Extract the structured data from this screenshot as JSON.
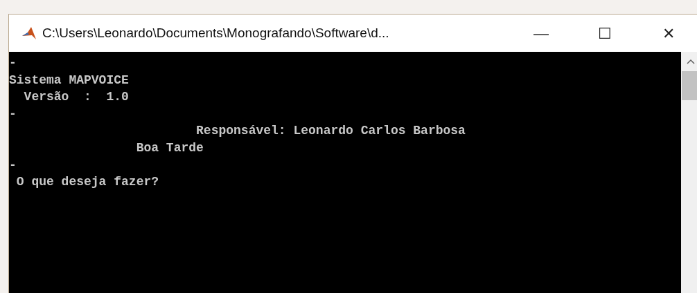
{
  "window": {
    "title": "C:\\Users\\Leonardo\\Documents\\Monografando\\Software\\d...",
    "controls": [
      "—",
      "☐",
      "✕"
    ]
  },
  "console": {
    "lines": [
      "-",
      "Sistema MAPVOICE",
      "  Versão  :  1.0",
      "-",
      "                         Responsável: Leonardo Carlos Barbosa",
      "                 Boa Tarde",
      "-",
      " O que deseja fazer?"
    ]
  }
}
